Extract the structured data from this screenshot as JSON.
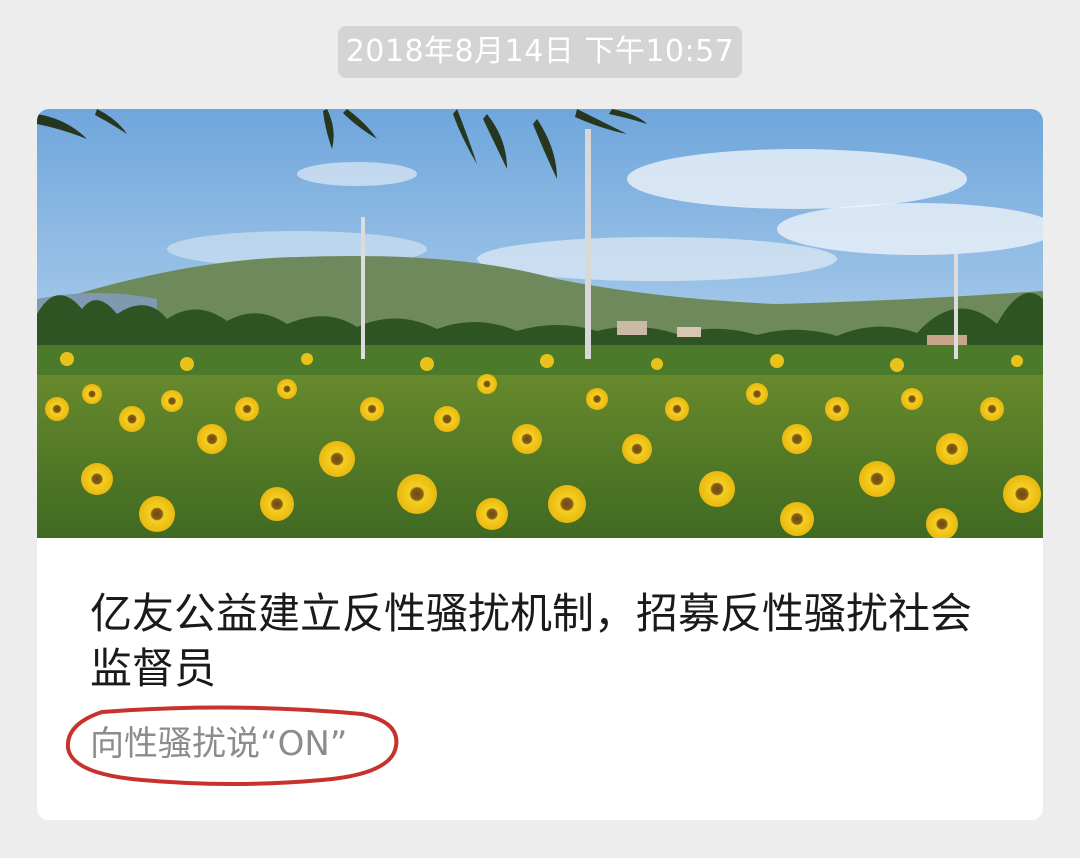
{
  "chat": {
    "timestamp": "2018年8月14日 下午10:57"
  },
  "article_card": {
    "title": "亿友公益建立反性骚扰机制，招募反性骚扰社会监督员",
    "digest": "向性骚扰说“ON”",
    "cover_image": "sunflower-field-photo",
    "annotation": "red-ellipse-around-digest"
  },
  "colors": {
    "page_background": "#ededed",
    "timestamp_background": "#d4d4d4",
    "card_background": "#ffffff",
    "title_text": "#1a1a1a",
    "digest_text": "#8c8c8c",
    "annotation_red": "#c8322c",
    "sunflower": "#f2c51c"
  }
}
